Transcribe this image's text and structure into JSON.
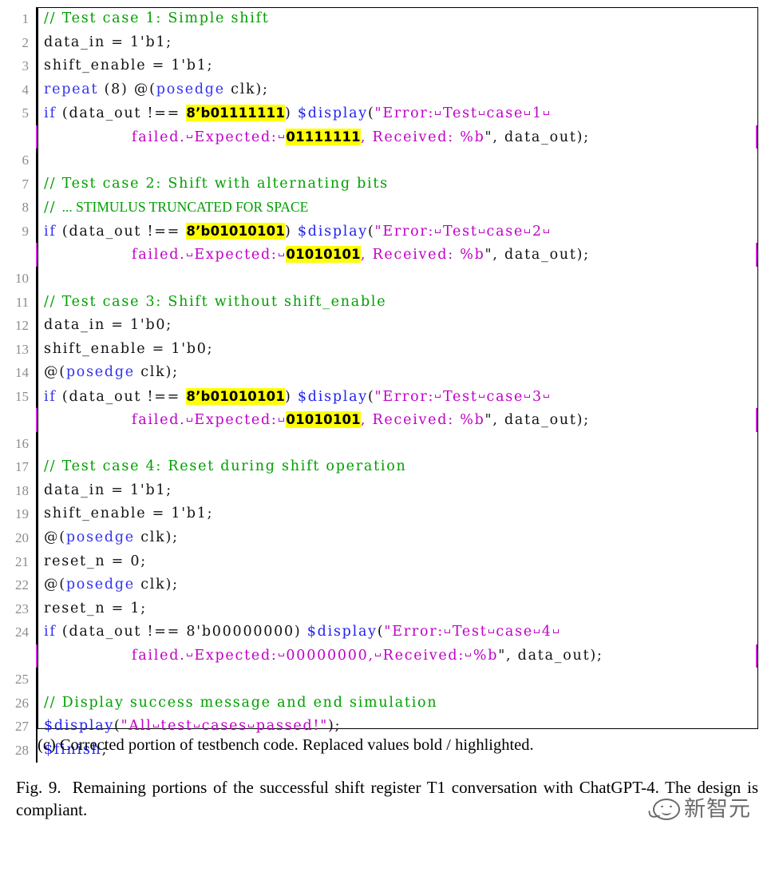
{
  "figure": {
    "subcaption": "(c) Corrected portion of testbench code. Replaced values bold / highlighted.",
    "caption_label": "Fig. 9.",
    "caption_text": "Remaining portions of the successful shift register T1 conversation with ChatGPT-4. The design is compliant."
  },
  "colors": {
    "comment_green": "#00a000",
    "keyword_blue": "#3333ee",
    "string_purple": "#c000c8",
    "highlight_yellow": "#ffff00",
    "linenumber_gray": "#8c8c8c",
    "continuation_rule_magenta": "#cc22dd",
    "frame_black": "#000000"
  },
  "watermark": {
    "text": "新智元",
    "icon": "speech-bubble-smiley-icon"
  },
  "listing": {
    "language": "verilog",
    "first_line": 1,
    "last_line": 28,
    "lines": [
      {
        "n": "1",
        "continuation": false,
        "code": "// Test case 1: Simple shift"
      },
      {
        "n": "2",
        "continuation": false,
        "code": "data_in = 1'b1;"
      },
      {
        "n": "3",
        "continuation": false,
        "code": "shift_enable = 1'b1;"
      },
      {
        "n": "4",
        "continuation": false,
        "code": "repeat (8) @(posedge clk);"
      },
      {
        "n": "5",
        "continuation": false,
        "code": "if (data_out !== 8'b01111111) $display(\"Error: Test case 1 "
      },
      {
        "n": "",
        "continuation": true,
        "code": "failed. Expected: 01111111, Received: %b\", data_out);"
      },
      {
        "n": "6",
        "continuation": false,
        "code": ""
      },
      {
        "n": "7",
        "continuation": false,
        "code": "// Test case 2: Shift with alternating bits"
      },
      {
        "n": "8",
        "continuation": false,
        "code": "// ... STIMULUS TRUNCATED FOR SPACE"
      },
      {
        "n": "9",
        "continuation": false,
        "code": "if (data_out !== 8'b01010101) $display(\"Error: Test case 2 "
      },
      {
        "n": "",
        "continuation": true,
        "code": "failed. Expected: 01010101, Received: %b\", data_out);"
      },
      {
        "n": "10",
        "continuation": false,
        "code": ""
      },
      {
        "n": "11",
        "continuation": false,
        "code": "// Test case 3: Shift without shift_enable"
      },
      {
        "n": "12",
        "continuation": false,
        "code": "data_in = 1'b0;"
      },
      {
        "n": "13",
        "continuation": false,
        "code": "shift_enable = 1'b0;"
      },
      {
        "n": "14",
        "continuation": false,
        "code": "@(posedge clk);"
      },
      {
        "n": "15",
        "continuation": false,
        "code": "if (data_out !== 8'b01010101) $display(\"Error: Test case 3 "
      },
      {
        "n": "",
        "continuation": true,
        "code": "failed. Expected: 01010101, Received: %b\", data_out);"
      },
      {
        "n": "16",
        "continuation": false,
        "code": ""
      },
      {
        "n": "17",
        "continuation": false,
        "code": "// Test case 4: Reset during shift operation"
      },
      {
        "n": "18",
        "continuation": false,
        "code": "data_in = 1'b1;"
      },
      {
        "n": "19",
        "continuation": false,
        "code": "shift_enable = 1'b1;"
      },
      {
        "n": "20",
        "continuation": false,
        "code": "@(posedge clk);"
      },
      {
        "n": "21",
        "continuation": false,
        "code": "reset_n = 0;"
      },
      {
        "n": "22",
        "continuation": false,
        "code": "@(posedge clk);"
      },
      {
        "n": "23",
        "continuation": false,
        "code": "reset_n = 1;"
      },
      {
        "n": "24",
        "continuation": false,
        "code": "if (data_out !== 8'b00000000) $display(\"Error: Test case 4 "
      },
      {
        "n": "",
        "continuation": true,
        "code": "failed. Expected: 00000000, Received: %b\", data_out);"
      },
      {
        "n": "25",
        "continuation": false,
        "code": ""
      },
      {
        "n": "26",
        "continuation": false,
        "code": "// Display success message and end simulation"
      },
      {
        "n": "27",
        "continuation": false,
        "code": "$display(\"All test cases passed!\");"
      },
      {
        "n": "28",
        "continuation": false,
        "code": "$finish;"
      }
    ],
    "highlighted_values": [
      "8'b01111111",
      "01111111",
      "8'b01010101",
      "01010101",
      "8'b01010101",
      "01010101"
    ]
  }
}
